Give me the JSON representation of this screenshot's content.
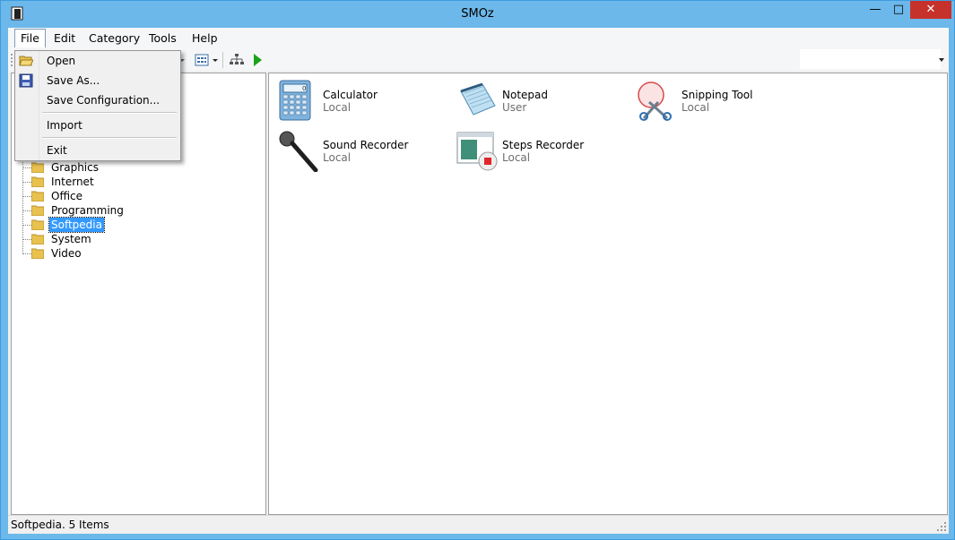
{
  "window": {
    "title": "SMOz",
    "min_glyph": "—",
    "max_glyph": "□",
    "close_glyph": "✕"
  },
  "menubar": {
    "items": [
      "File",
      "Edit",
      "Category",
      "Tools",
      "Help"
    ]
  },
  "file_menu": {
    "items": [
      "Open",
      "Save As...",
      "Save Configuration...",
      "Import",
      "Exit"
    ]
  },
  "tree": {
    "items": [
      "Graphics",
      "Internet",
      "Office",
      "Programming",
      "Softpedia",
      "System",
      "Video"
    ],
    "selected": "Softpedia"
  },
  "apps": [
    {
      "name": "Calculator",
      "type": "Local",
      "icon": "calculator-icon"
    },
    {
      "name": "Notepad",
      "type": "User",
      "icon": "notepad-icon"
    },
    {
      "name": "Snipping Tool",
      "type": "Local",
      "icon": "scissors-icon"
    },
    {
      "name": "Sound Recorder",
      "type": "Local",
      "icon": "microphone-icon"
    },
    {
      "name": "Steps Recorder",
      "type": "Local",
      "icon": "steps-recorder-icon"
    }
  ],
  "status": {
    "text": "Softpedia. 5 Items"
  },
  "colors": {
    "selection": "#3399ff",
    "titlebar": "#6cb8ea",
    "close": "#c7312b"
  }
}
